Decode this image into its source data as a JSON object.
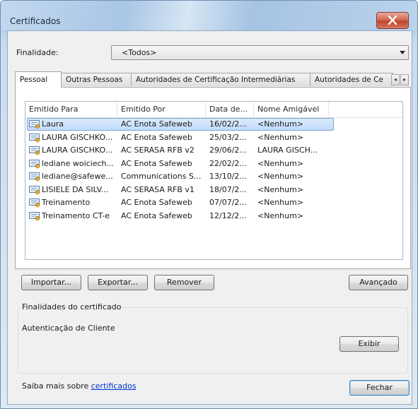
{
  "window": {
    "title": "Certificados"
  },
  "purpose": {
    "label": "Finalidade:",
    "selected": "<Todos>"
  },
  "tabs": [
    {
      "label": "Pessoal",
      "active": true
    },
    {
      "label": "Outras Pessoas",
      "active": false
    },
    {
      "label": "Autoridades de Certificação Intermediárias",
      "active": false
    },
    {
      "label": "Autoridades de Ce",
      "active": false
    }
  ],
  "tab_scroll": {
    "left": "◂",
    "right": "▸"
  },
  "list": {
    "columns": [
      "Emitido Para",
      "Emitido Por",
      "Data de...",
      "Nome Amigável"
    ],
    "rows": [
      {
        "issued_to": "Laura",
        "issued_by": "AC Enota Safeweb",
        "date": "16/02/2...",
        "friendly": "<Nenhum>",
        "selected": true
      },
      {
        "issued_to": "LAURA GISCHKO...",
        "issued_by": "AC Enota Safeweb",
        "date": "25/03/2...",
        "friendly": "<Nenhum>"
      },
      {
        "issued_to": "LAURA GISCHKO...",
        "issued_by": "AC SERASA RFB v2",
        "date": "29/06/2...",
        "friendly": "LAURA GISCH..."
      },
      {
        "issued_to": "lediane woiciech...",
        "issued_by": "AC Enota Safeweb",
        "date": "22/02/2...",
        "friendly": "<Nenhum>"
      },
      {
        "issued_to": "lediane@safewe...",
        "issued_by": "Communications S...",
        "date": "13/10/2...",
        "friendly": "<Nenhum>"
      },
      {
        "issued_to": "LISIELE DA SILV...",
        "issued_by": "AC SERASA RFB v1",
        "date": "18/07/2...",
        "friendly": "<Nenhum>"
      },
      {
        "issued_to": "Treinamento",
        "issued_by": "AC Enota Safeweb",
        "date": "07/07/2...",
        "friendly": "<Nenhum>"
      },
      {
        "issued_to": "Treinamento CT-e",
        "issued_by": "AC Enota Safeweb",
        "date": "12/12/2...",
        "friendly": "<Nenhum>"
      }
    ]
  },
  "buttons": {
    "import": "Importar...",
    "export": "Exportar...",
    "remove": "Remover",
    "advanced": "Avançado",
    "view": "Exibir",
    "close": "Fechar"
  },
  "purposes_group": {
    "title": "Finalidades do certificado",
    "value": "Autenticação de Cliente"
  },
  "footer": {
    "text": "Saiba mais sobre ",
    "link": "certificados"
  },
  "colors": {
    "selection": "#c1dcfc",
    "link": "#0033cc",
    "close_button": "#c2452c"
  }
}
